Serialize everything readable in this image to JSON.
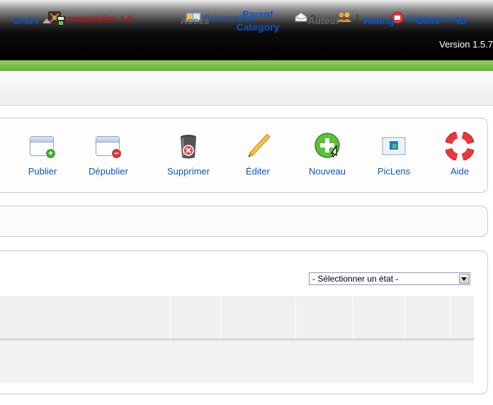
{
  "header": {
    "version": "Version 1.5.7"
  },
  "status": {
    "compat": "compatibilité: 1.0",
    "preview": "Prévisualiser",
    "messages_count": "0",
    "users_count": "1",
    "logout": "Déconnexion"
  },
  "toolbar": {
    "publish": "Publier",
    "unpublish": "Dépublier",
    "delete": "Supprimer",
    "edit": "Éditer",
    "new": "Nouveau",
    "piclens": "PicLens",
    "help": "Aide"
  },
  "filter": {
    "state_select": "- Sélectionner un état -"
  },
  "table": {
    "columns": [
      "Ordre",
      "Accès",
      "Parent Category",
      "Auteur",
      "Rating",
      "Clics",
      "ID"
    ]
  },
  "colors": {
    "link": "#0b55c4",
    "brand_green": "#63b132",
    "alert_red": "#cc0000"
  }
}
